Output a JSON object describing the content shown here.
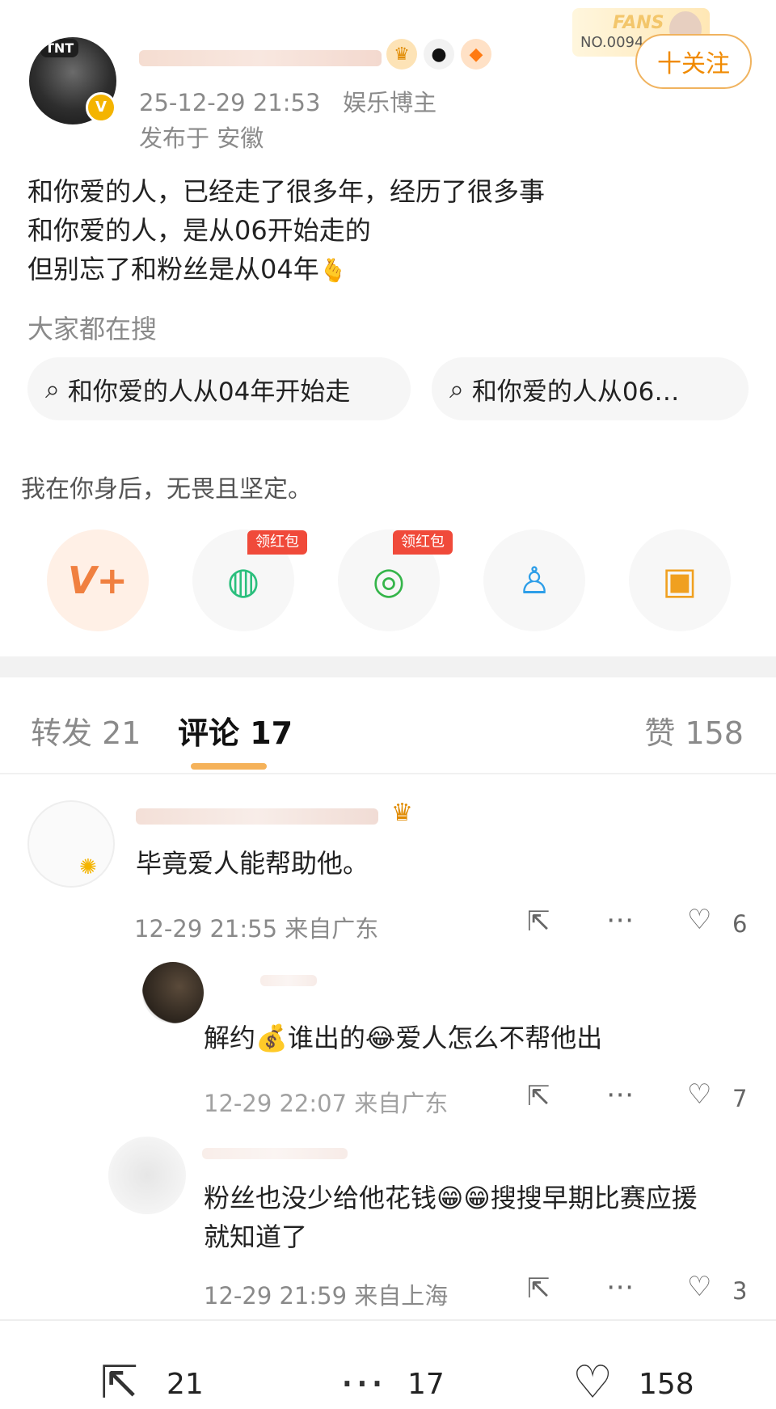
{
  "post": {
    "avatar_tag": "TNT",
    "timestamp": "25-12-29 21:53",
    "author_type": "娱乐博主",
    "location": "发布于 安徽",
    "fans_badge_title": "FANS",
    "fans_badge_no": "NO.0094",
    "follow_label": "十关注",
    "lines": [
      "和你爱的人，已经走了很多年，经历了很多事",
      "和你爱的人，是从06开始走的",
      "但别忘了和粉丝是从04年"
    ]
  },
  "hot_search": {
    "title": "大家都在搜",
    "items": [
      "和你爱的人从04年开始走",
      "和你爱的人从06…"
    ]
  },
  "tagline": "我在你身后，无畏且坚定。",
  "share": {
    "redpack_label": "领红包",
    "icons": [
      "vplus-icon",
      "wechat-icon",
      "moments-icon",
      "qq-icon",
      "save-image-icon"
    ]
  },
  "tabs": {
    "repost": "转发 21",
    "comments": "评论 17",
    "likes": "赞 158"
  },
  "comments": [
    {
      "text": "毕竟爱人能帮助他。",
      "time": "12-29 21:55",
      "from": "来自广东",
      "likes": "6"
    },
    {
      "text": "解约💰谁出的😂爱人怎么不帮他出",
      "time": "12-29 22:07",
      "from": "来自广东",
      "likes": "7"
    },
    {
      "text": "粉丝也没少给他花钱😁😁搜搜早期比赛应援",
      "text2": "就知道了",
      "time": "12-29 21:59",
      "from": "来自上海",
      "likes": "3"
    }
  ],
  "bottom_bar": {
    "repost_count": "21",
    "comment_count": "17",
    "like_count": "158"
  },
  "colors": {
    "accent_orange": "#f08a00",
    "meta_gray": "#8a8a8a",
    "redpack": "#f04a3a"
  }
}
